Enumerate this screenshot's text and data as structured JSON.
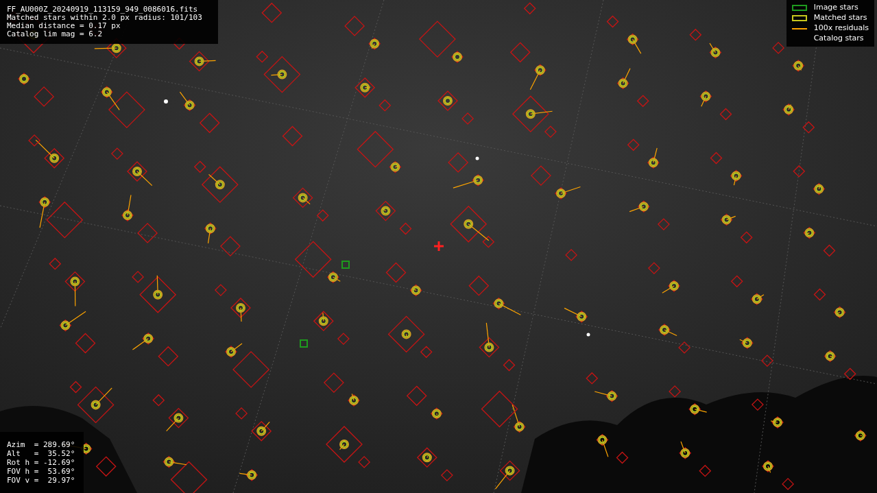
{
  "info": {
    "lines": [
      "FF_AU000Z_20240919_113159_949_0086016.fits",
      "Matched stars within 2.0 px radius: 101/103",
      "Median distance = 0.17 px",
      "Catalog lim mag = 6.2"
    ]
  },
  "legend": [
    {
      "label": "Image stars",
      "kind": "box",
      "color": "#1e9a1e"
    },
    {
      "label": "Matched stars",
      "kind": "box",
      "color": "#c8c81e"
    },
    {
      "label": "100x residuals",
      "kind": "line",
      "color": "#ffa500"
    },
    {
      "label": "Catalog stars",
      "kind": "none"
    }
  ],
  "pointing": {
    "lines": [
      "Azim  = 289.69°",
      "Alt   =  35.52°",
      "Rot h = -12.69°",
      "FOV h =  53.69°",
      "FOV v =  29.97°"
    ]
  }
}
